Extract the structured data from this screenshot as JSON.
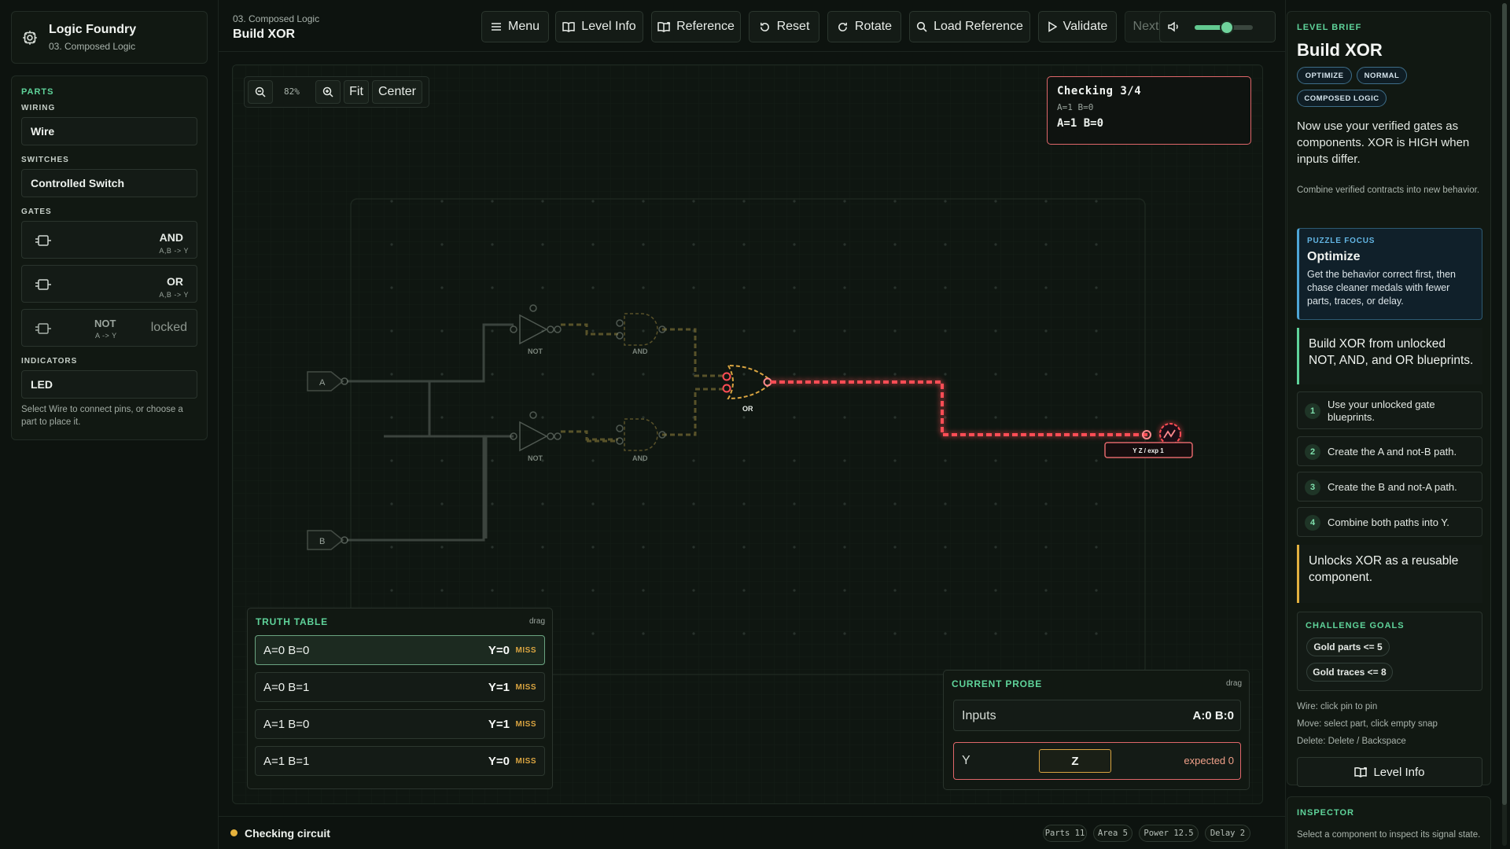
{
  "app": {
    "name": "Logic Foundry",
    "subtitle": "03. Composed Logic"
  },
  "header": {
    "breadcrumb": "03. Composed Logic",
    "title": "Build XOR"
  },
  "toolbar": {
    "menu": "Menu",
    "level_info": "Level Info",
    "reference": "Reference",
    "reset": "Reset",
    "rotate": "Rotate",
    "load_reference": "Load Reference",
    "validate": "Validate",
    "next": "Next",
    "volume_level": 0.55
  },
  "parts": {
    "title": "PARTS",
    "wiring_label": "WIRING",
    "wire": "Wire",
    "switches_label": "SWITCHES",
    "controlled_switch": "Controlled Switch",
    "gates_label": "GATES",
    "gates": [
      {
        "name": "AND",
        "sig": "A,B -> Y",
        "locked": false
      },
      {
        "name": "OR",
        "sig": "A,B -> Y",
        "locked": false
      },
      {
        "name": "NOT",
        "sig": "A -> Y",
        "locked": true,
        "lock_label": "locked"
      }
    ],
    "indicators_label": "INDICATORS",
    "led": "LED",
    "hint": "Select Wire to connect pins, or choose a part to place it."
  },
  "board": {
    "zoom": "82%",
    "fit": "Fit",
    "center": "Center",
    "checking": {
      "title": "Checking 3/4",
      "sub": "A=1 B=0",
      "value": "A=1 B=0"
    },
    "labels": {
      "input_a": "A",
      "input_b": "B",
      "not": "NOT",
      "and": "AND",
      "or": "OR",
      "output": "Y Z / exp 1"
    },
    "colors": {
      "error": "#ff4d55",
      "warn": "#d9a441",
      "ok": "#5fd39a"
    }
  },
  "truth_table": {
    "title": "TRUTH TABLE",
    "drag": "drag",
    "rows": [
      {
        "inputs": "A=0 B=0",
        "output": "Y=0",
        "status": "MISS",
        "active": true
      },
      {
        "inputs": "A=0 B=1",
        "output": "Y=1",
        "status": "MISS",
        "active": false
      },
      {
        "inputs": "A=1 B=0",
        "output": "Y=1",
        "status": "MISS",
        "active": false
      },
      {
        "inputs": "A=1 B=1",
        "output": "Y=0",
        "status": "MISS",
        "active": false
      }
    ]
  },
  "probe": {
    "title": "CURRENT PROBE",
    "drag": "drag",
    "inputs_label": "Inputs",
    "inputs_value": "A:0 B:0",
    "y_label": "Y",
    "y_value": "Z",
    "expected": "expected 0"
  },
  "status": {
    "text": "Checking circuit",
    "parts": "Parts 11",
    "area": "Area 5",
    "power": "Power 12.5",
    "delay": "Delay 2"
  },
  "brief": {
    "label": "LEVEL BRIEF",
    "title": "Build XOR",
    "tags": [
      "OPTIMIZE",
      "NORMAL",
      "COMPOSED LOGIC"
    ],
    "intro": "Now use your verified gates as components. XOR is HIGH when inputs differ.",
    "note": "Combine verified contracts into new behavior.",
    "focus": {
      "kicker": "PUZZLE FOCUS",
      "title": "Optimize",
      "desc": "Get the behavior correct first, then chase cleaner medals with fewer parts, traces, or delay."
    },
    "callout": "Build XOR from unlocked NOT, AND, and OR blueprints.",
    "steps": [
      {
        "n": "1",
        "text": "Use your unlocked gate blueprints."
      },
      {
        "n": "2",
        "text": "Create the A and not-B path."
      },
      {
        "n": "3",
        "text": "Create the B and not-A path."
      },
      {
        "n": "4",
        "text": "Combine both paths into Y."
      }
    ],
    "unlocks": "Unlocks XOR as a reusable component.",
    "goals_label": "CHALLENGE GOALS",
    "goals": [
      "Gold parts <= 5",
      "Gold traces <= 8"
    ],
    "help": [
      "Wire: click pin to pin",
      "Move: select part, click empty snap",
      "Delete: Delete / Backspace"
    ],
    "level_info": "Level Info"
  },
  "inspector": {
    "label": "INSPECTOR",
    "text": "Select a component to inspect its signal state."
  }
}
